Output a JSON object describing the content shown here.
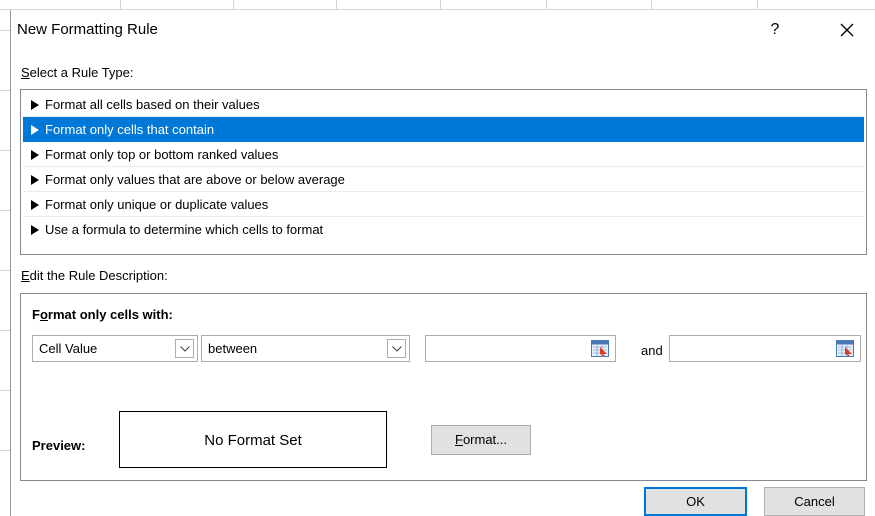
{
  "dialog": {
    "title": "New Formatting Rule",
    "help_label": "?"
  },
  "rule_type": {
    "label_access": "S",
    "label_rest": "elect a Rule Type:",
    "items": [
      {
        "label": "Format all cells based on their values",
        "selected": false
      },
      {
        "label": "Format only cells that contain",
        "selected": true
      },
      {
        "label": "Format only top or bottom ranked values",
        "selected": false
      },
      {
        "label": "Format only values that are above or below average",
        "selected": false
      },
      {
        "label": "Format only unique or duplicate values",
        "selected": false
      },
      {
        "label": "Use a formula to determine which cells to format",
        "selected": false
      }
    ]
  },
  "description": {
    "label_access": "E",
    "label_rest": "dit the Rule Description:",
    "format_with_pre": "F",
    "format_with_access": "o",
    "format_with_rest": "rmat only cells with:",
    "condition_combo": "Cell Value",
    "operator_combo": "between",
    "value1": "",
    "and_label": "and",
    "value2": "",
    "preview_label": "Preview:",
    "preview_text": "No Format Set",
    "format_button_access": "F",
    "format_button_rest": "ormat..."
  },
  "buttons": {
    "ok": "OK",
    "cancel": "Cancel"
  },
  "colors": {
    "selection": "#0078d7",
    "button_face": "#e1e1e1",
    "border": "#828790"
  }
}
